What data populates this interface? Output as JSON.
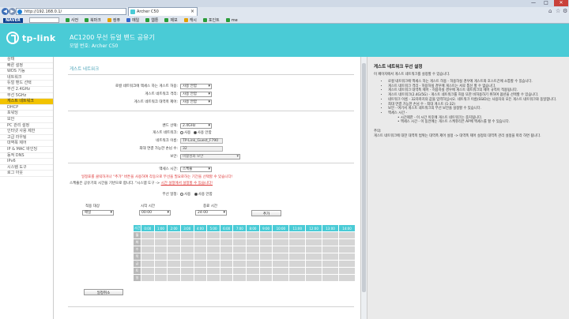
{
  "browser": {
    "address": "http://192.168.0.1/",
    "tab_title": "Archer C50",
    "window_buttons": [
      "—",
      "□",
      "✕"
    ],
    "favorites": [
      {
        "label": "NAVER",
        "color": "#0b3f8f"
      },
      {
        "label": "사전",
        "color": "#2a9d3a"
      },
      {
        "label": "북마크",
        "color": "#2a9d3a"
      },
      {
        "label": "컴퓨",
        "color": "#e2a000"
      },
      {
        "label": "메일",
        "color": "#3366cc"
      },
      {
        "label": "웹툰",
        "color": "#2a9d3a"
      },
      {
        "label": "제보",
        "color": "#2a9d3a"
      },
      {
        "label": "캐시",
        "color": "#e2a000"
      },
      {
        "label": "포인트",
        "color": "#2a9d3a"
      },
      {
        "label": "me",
        "color": "#2a9d3a"
      }
    ]
  },
  "header": {
    "logo": "tp-link",
    "product_title": "AC1200 무선 듀얼 밴드 공유기",
    "model": "모델 번호: Archer C50"
  },
  "sidebar": {
    "items": [
      "상태",
      "빠른 설정",
      "WDS 기능",
      "네트워크",
      "듀얼 밴드 선택",
      "무선 2.4GHz",
      "무선 5GHz",
      "게스트 네트워크",
      "DHCP",
      "포워딩",
      "보안",
      "PC 관리 설정",
      "인터넷 사용 제한",
      "고급 라우팅",
      "대역폭 제어",
      "IP & MAC 바인딩",
      "동적 DNS",
      "IPv6",
      "시스템 도구",
      "로그 아웃"
    ],
    "active_index": 7
  },
  "main": {
    "section_title": "게스트 네트워크",
    "access_rows": [
      {
        "label": "로컬 네트워크에 액세스 하는 게스트 허용:",
        "value": "사용 안함"
      },
      {
        "label": "게스트 네트워크 격리:",
        "value": "사용 안함"
      },
      {
        "label": "게스트 네트워크 대역폭 제어:",
        "value": "사용 안함"
      }
    ],
    "band_label": "밴드 선택:",
    "band_value": "2.4GHz",
    "guest_net_label": "게스트 네트워크:",
    "guest_net_opt1": "사용",
    "guest_net_opt2": "사용 안함",
    "name_label": "네트워크 이름:",
    "name_value": "TP-Link_Guest_F790",
    "max_label": "최대 연결 가능한 손님 수:",
    "max_value": "32",
    "security_label": "보안:",
    "security_value": "비활성화 보안",
    "access_time_label": "액세스 시간:",
    "access_time_value": "스케쥴",
    "warn_red": "일정표를 클릭하거나 \"추가\" 버튼을 사용하여 각동으로 무선을 필요로하는 기간을 선택할 수 있습니다!",
    "warn_black": "스케쥴은 공유기의 시간을 기반으로 합니다. \"시스템 도구 -> ",
    "warn_link": "시간 설정에서 설정할 수 있습니다!",
    "wireless_rule_label": "무선 일정:",
    "wireless_rule_opt1": "사용",
    "wireless_rule_opt2": "사용 안함",
    "cols": {
      "target": "적용 대상",
      "start": "시작 시간",
      "end": "종료 시간"
    },
    "target_value": "매일",
    "start_value": "00:00",
    "end_value": "24:00",
    "add_button": "추가",
    "grid_header": [
      "시간",
      "0:00",
      "1:00",
      "2:00",
      "3:00",
      "4:00",
      "5:00",
      "6:00",
      "7:00",
      "8:00",
      "9:00",
      "10:00",
      "11:00",
      "12:00",
      "13:00",
      "14:00"
    ],
    "days": [
      "월",
      "화",
      "수",
      "목",
      "금",
      "토",
      "일"
    ],
    "save_button": "일정취소"
  },
  "help": {
    "title": "게스트 네트워크 무선 설정",
    "intro": "이 페이지에서 게스트 네트워크를 설정할 수 있습니다.",
    "bullets": [
      "로컬 네트워크에 액세스 하는 게스트 허용 - 허용하실 경우에 게스트와 호스트간에 소통할 수 있습니다.",
      "게스트 네트워크 격리 - 허용하실 경우에 게스트는 서로 통신 할 수 없습니다.",
      "게스트 네트워크 대역폭 제어 - 허용하실 경우에 게스트 네트워크의 제어 규칙이 적용됩니다.",
      "게스트 네트워크(2.4G/5G) - 게스트 네트워크를 허용 또한 비허용하기 위하여 옵션을 선택할 수 있습니다.",
      "네트워크 이름 - 32자까지의 값을 입력하십시오. 네트워크 이름(SSID)는 사용자의 모든 게스트 네트워크와 동일합니다.",
      "최대 연결 가능한 손님 수 - 최대 게스트 (1-32)",
      "보안 - 여기서 게스트 네트워크의 무선 보안을 설정할 수 있습니다.",
      "액세스 시간 -"
    ],
    "sub": [
      "시간제한 - 이 시간 이후에 게스트 네트워크는 중지됩니다.",
      "액세스 시간 - 이 동안에는 게스트 스케쥬리은 AP에 액세스를 할 수 있습니다."
    ],
    "note_label": "주의:",
    "note": "게스트 네트워크에 대한 대역폭 범위는 대역폭 제어 설정 -> 대역폭 제어 설정의 대역폭 관리 설정을 따라 하면 됩니다."
  }
}
